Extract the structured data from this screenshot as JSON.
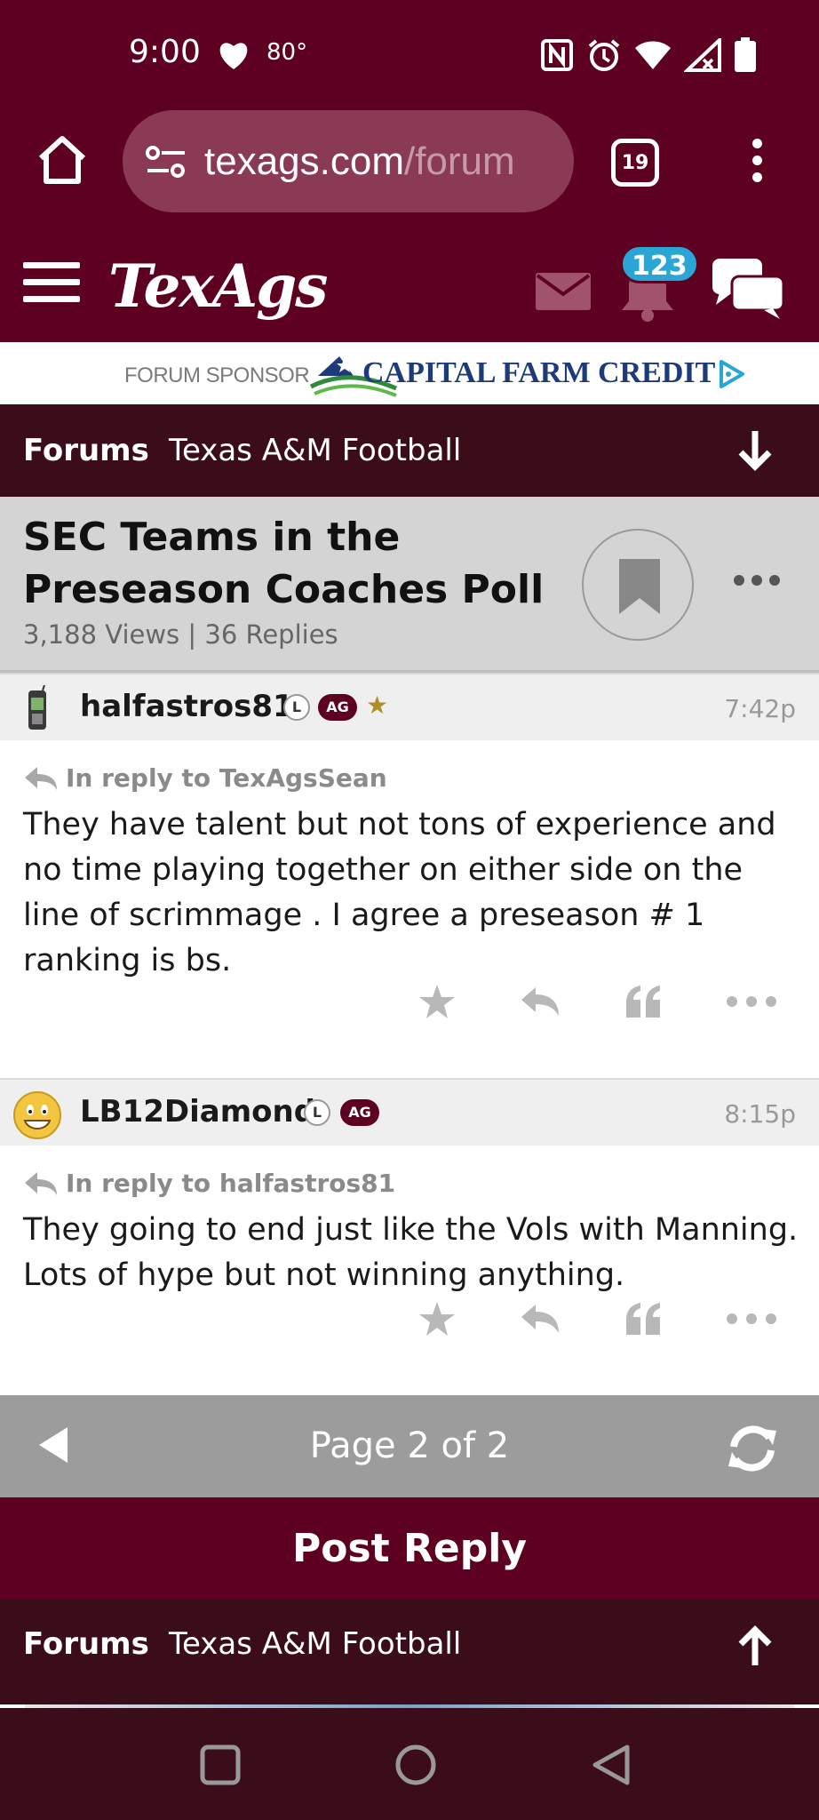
{
  "status_bar": {
    "time": "9:00",
    "temperature": "80°"
  },
  "browser": {
    "url_host": "texags.com",
    "url_path": "/forum",
    "tab_count": "19"
  },
  "site_header": {
    "logo": "TexAgs",
    "notification_count": "123"
  },
  "sponsor": {
    "label": "FORUM SPONSOR",
    "brand": "CAPITAL FARM CREDIT"
  },
  "breadcrumb": {
    "forums": "Forums",
    "board": "Texas A&M Football"
  },
  "thread": {
    "title": "SEC Teams in the Preseason Coaches Poll",
    "meta": "3,188 Views | 36 Replies"
  },
  "posts": [
    {
      "username": "halfastros81",
      "badge_l": "L",
      "badge_ag": "AG",
      "star": "★",
      "time": "7:42p",
      "reply_to": "In reply to TexAgsSean",
      "text": "They have talent but not tons of experience and no time playing together on either side on the line of scrimmage . I agree a preseason # 1 ranking is bs."
    },
    {
      "username": "LB12Diamond",
      "badge_l": "L",
      "badge_ag": "AG",
      "time": "8:15p",
      "reply_to": "In reply to halfastros81",
      "text": "They going to end just like the Vols with Manning. Lots of hype but not winning anything."
    }
  ],
  "pager": {
    "label": "Page 2 of 2"
  },
  "post_reply": {
    "label": "Post Reply"
  },
  "colors": {
    "maroon": "#5e0022",
    "dark_maroon": "#3b0d1a",
    "badge_blue": "#2aa6d6"
  }
}
